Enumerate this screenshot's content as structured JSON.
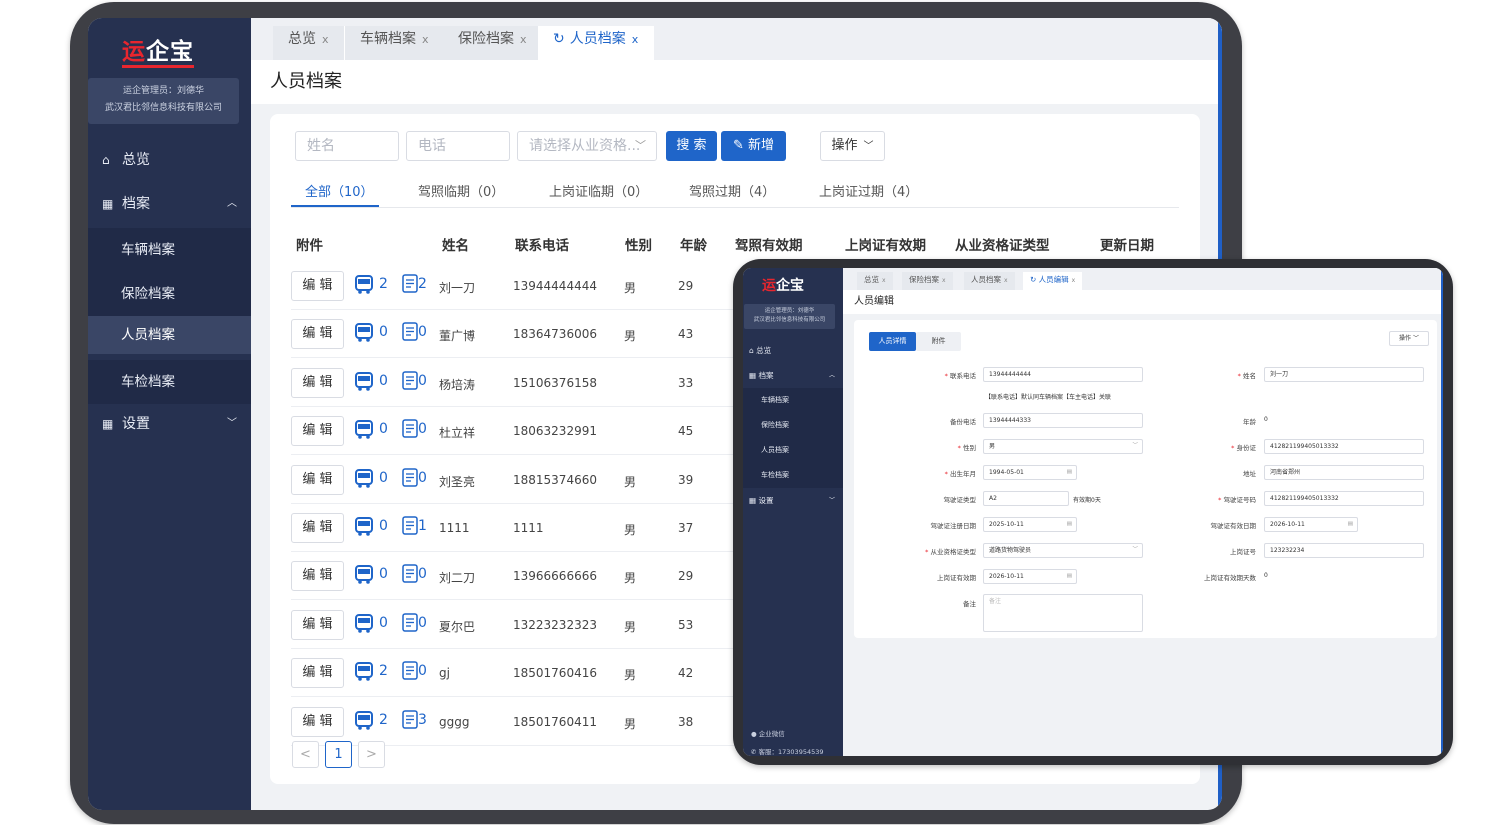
{
  "app": {
    "logo_red": "运",
    "logo_rest": "企宝"
  },
  "user": {
    "line1": "运企管理员：刘德华",
    "line2": "武汉君比邻信息科技有限公司"
  },
  "sidebar": {
    "overview": "总览",
    "archive": "档案",
    "sub": [
      "车辆档案",
      "保险档案",
      "人员档案",
      "车检档案"
    ],
    "settings": "设置"
  },
  "tabs": [
    {
      "label": "总览"
    },
    {
      "label": "车辆档案"
    },
    {
      "label": "保险档案"
    },
    {
      "label": "人员档案"
    }
  ],
  "page_title": "人员档案",
  "filters": {
    "name_placeholder": "姓名",
    "phone_placeholder": "电话",
    "qual_placeholder": "请选择从业资格...",
    "search": "搜 索",
    "add": "新增",
    "ops": "操作"
  },
  "filter_tabs": [
    "全部（10）",
    "驾照临期（0）",
    "上岗证临期（0）",
    "驾照过期（4）",
    "上岗证过期（4）"
  ],
  "columns": [
    "附件",
    "姓名",
    "联系电话",
    "性别",
    "年龄",
    "驾照有效期",
    "上岗证有效期",
    "从业资格证类型",
    "更新日期"
  ],
  "edit_label": "编 辑",
  "rows": [
    {
      "bus": "2",
      "doc": "2",
      "name": "刘一刀",
      "phone": "13944444444",
      "gender": "男",
      "age": "29"
    },
    {
      "bus": "0",
      "doc": "0",
      "name": "董广博",
      "phone": "18364736006",
      "gender": "男",
      "age": "43"
    },
    {
      "bus": "0",
      "doc": "0",
      "name": "杨培涛",
      "phone": "15106376158",
      "gender": "",
      "age": "33"
    },
    {
      "bus": "0",
      "doc": "0",
      "name": "杜立祥",
      "phone": "18063232991",
      "gender": "",
      "age": "45"
    },
    {
      "bus": "0",
      "doc": "0",
      "name": "刘圣亮",
      "phone": "18815374660",
      "gender": "男",
      "age": "39"
    },
    {
      "bus": "0",
      "doc": "1",
      "name": "1111",
      "phone": "1111",
      "gender": "男",
      "age": "37"
    },
    {
      "bus": "0",
      "doc": "0",
      "name": "刘二刀",
      "phone": "13966666666",
      "gender": "男",
      "age": "29"
    },
    {
      "bus": "0",
      "doc": "0",
      "name": "夏尔巴",
      "phone": "13223232323",
      "gender": "男",
      "age": "53"
    },
    {
      "bus": "2",
      "doc": "0",
      "name": "gj",
      "phone": "18501760416",
      "gender": "男",
      "age": "42"
    },
    {
      "bus": "2",
      "doc": "3",
      "name": "gggg",
      "phone": "18501760411",
      "gender": "男",
      "age": "38"
    }
  ],
  "pagination": {
    "prev": "<",
    "current": "1",
    "next": ">"
  },
  "edit_view": {
    "tabs": [
      {
        "label": "总览"
      },
      {
        "label": "保险档案"
      },
      {
        "label": "人员档案"
      },
      {
        "label": "人员编辑"
      }
    ],
    "page_title": "人员编辑",
    "subtabs": [
      "人员详情",
      "附件"
    ],
    "ops": "操作",
    "footer1": "企业微信",
    "footer2": "客服：17303954539",
    "labels": {
      "phone": "联系电话",
      "name": "姓名",
      "backup_phone": "备份电话",
      "age": "年龄",
      "gender": "性别",
      "idcard": "身份证",
      "birth": "出生年月",
      "address": "地址",
      "license_type": "驾驶证类型",
      "license_no": "驾驶证号码",
      "license_reg": "驾驶证注册日期",
      "license_exp": "驾驶证有效日期",
      "qual_type": "从业资格证类型",
      "post_no": "上岗证号",
      "post_exp": "上岗证有效期",
      "post_days": "上岗证有效期天数",
      "remark": "备注"
    },
    "values": {
      "phone": "13944444444",
      "phone_hint": "【联系电话】默认同车辆档案【车主电话】关联",
      "name": "刘一刀",
      "backup_phone": "13944444333",
      "age": "0",
      "gender": "男",
      "idcard": "412821199405013332",
      "birth": "1994-05-01",
      "address": "河南省郑州",
      "license_type": "A2",
      "license_hint": "有效期0天",
      "license_no": "412821199405013332",
      "license_reg": "2025-10-11",
      "license_exp": "2026-10-11",
      "qual_type": "道路货物驾驶员",
      "post_no": "123232234",
      "post_exp": "2026-10-11",
      "post_days": "0",
      "remark_placeholder": "备注"
    }
  },
  "colors": {
    "sidebar": "#263150",
    "accent": "#1f65c9",
    "brand_red": "#e8262e"
  }
}
